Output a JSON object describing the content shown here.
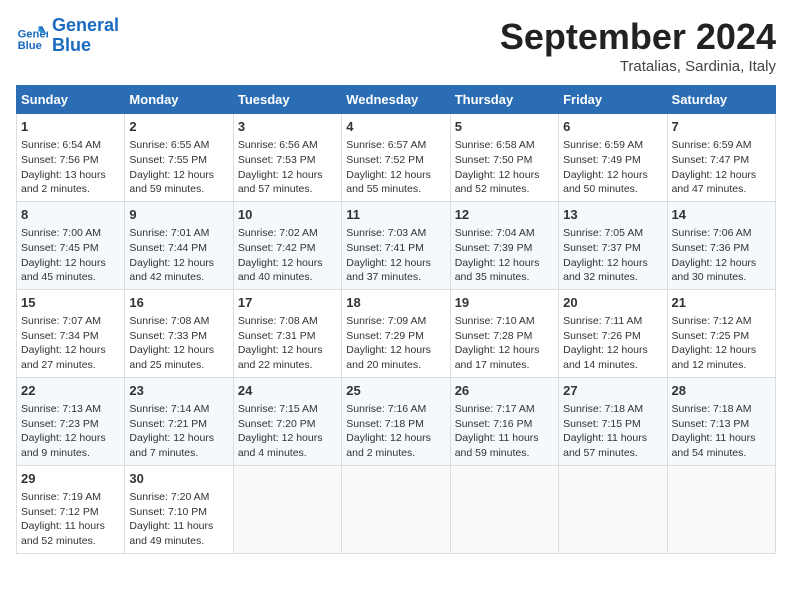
{
  "logo": {
    "line1": "General",
    "line2": "Blue"
  },
  "title": "September 2024",
  "location": "Tratalias, Sardinia, Italy",
  "weekdays": [
    "Sunday",
    "Monday",
    "Tuesday",
    "Wednesday",
    "Thursday",
    "Friday",
    "Saturday"
  ],
  "weeks": [
    [
      {
        "day": "1",
        "lines": [
          "Sunrise: 6:54 AM",
          "Sunset: 7:56 PM",
          "Daylight: 13 hours",
          "and 2 minutes."
        ]
      },
      {
        "day": "2",
        "lines": [
          "Sunrise: 6:55 AM",
          "Sunset: 7:55 PM",
          "Daylight: 12 hours",
          "and 59 minutes."
        ]
      },
      {
        "day": "3",
        "lines": [
          "Sunrise: 6:56 AM",
          "Sunset: 7:53 PM",
          "Daylight: 12 hours",
          "and 57 minutes."
        ]
      },
      {
        "day": "4",
        "lines": [
          "Sunrise: 6:57 AM",
          "Sunset: 7:52 PM",
          "Daylight: 12 hours",
          "and 55 minutes."
        ]
      },
      {
        "day": "5",
        "lines": [
          "Sunrise: 6:58 AM",
          "Sunset: 7:50 PM",
          "Daylight: 12 hours",
          "and 52 minutes."
        ]
      },
      {
        "day": "6",
        "lines": [
          "Sunrise: 6:59 AM",
          "Sunset: 7:49 PM",
          "Daylight: 12 hours",
          "and 50 minutes."
        ]
      },
      {
        "day": "7",
        "lines": [
          "Sunrise: 6:59 AM",
          "Sunset: 7:47 PM",
          "Daylight: 12 hours",
          "and 47 minutes."
        ]
      }
    ],
    [
      {
        "day": "8",
        "lines": [
          "Sunrise: 7:00 AM",
          "Sunset: 7:45 PM",
          "Daylight: 12 hours",
          "and 45 minutes."
        ]
      },
      {
        "day": "9",
        "lines": [
          "Sunrise: 7:01 AM",
          "Sunset: 7:44 PM",
          "Daylight: 12 hours",
          "and 42 minutes."
        ]
      },
      {
        "day": "10",
        "lines": [
          "Sunrise: 7:02 AM",
          "Sunset: 7:42 PM",
          "Daylight: 12 hours",
          "and 40 minutes."
        ]
      },
      {
        "day": "11",
        "lines": [
          "Sunrise: 7:03 AM",
          "Sunset: 7:41 PM",
          "Daylight: 12 hours",
          "and 37 minutes."
        ]
      },
      {
        "day": "12",
        "lines": [
          "Sunrise: 7:04 AM",
          "Sunset: 7:39 PM",
          "Daylight: 12 hours",
          "and 35 minutes."
        ]
      },
      {
        "day": "13",
        "lines": [
          "Sunrise: 7:05 AM",
          "Sunset: 7:37 PM",
          "Daylight: 12 hours",
          "and 32 minutes."
        ]
      },
      {
        "day": "14",
        "lines": [
          "Sunrise: 7:06 AM",
          "Sunset: 7:36 PM",
          "Daylight: 12 hours",
          "and 30 minutes."
        ]
      }
    ],
    [
      {
        "day": "15",
        "lines": [
          "Sunrise: 7:07 AM",
          "Sunset: 7:34 PM",
          "Daylight: 12 hours",
          "and 27 minutes."
        ]
      },
      {
        "day": "16",
        "lines": [
          "Sunrise: 7:08 AM",
          "Sunset: 7:33 PM",
          "Daylight: 12 hours",
          "and 25 minutes."
        ]
      },
      {
        "day": "17",
        "lines": [
          "Sunrise: 7:08 AM",
          "Sunset: 7:31 PM",
          "Daylight: 12 hours",
          "and 22 minutes."
        ]
      },
      {
        "day": "18",
        "lines": [
          "Sunrise: 7:09 AM",
          "Sunset: 7:29 PM",
          "Daylight: 12 hours",
          "and 20 minutes."
        ]
      },
      {
        "day": "19",
        "lines": [
          "Sunrise: 7:10 AM",
          "Sunset: 7:28 PM",
          "Daylight: 12 hours",
          "and 17 minutes."
        ]
      },
      {
        "day": "20",
        "lines": [
          "Sunrise: 7:11 AM",
          "Sunset: 7:26 PM",
          "Daylight: 12 hours",
          "and 14 minutes."
        ]
      },
      {
        "day": "21",
        "lines": [
          "Sunrise: 7:12 AM",
          "Sunset: 7:25 PM",
          "Daylight: 12 hours",
          "and 12 minutes."
        ]
      }
    ],
    [
      {
        "day": "22",
        "lines": [
          "Sunrise: 7:13 AM",
          "Sunset: 7:23 PM",
          "Daylight: 12 hours",
          "and 9 minutes."
        ]
      },
      {
        "day": "23",
        "lines": [
          "Sunrise: 7:14 AM",
          "Sunset: 7:21 PM",
          "Daylight: 12 hours",
          "and 7 minutes."
        ]
      },
      {
        "day": "24",
        "lines": [
          "Sunrise: 7:15 AM",
          "Sunset: 7:20 PM",
          "Daylight: 12 hours",
          "and 4 minutes."
        ]
      },
      {
        "day": "25",
        "lines": [
          "Sunrise: 7:16 AM",
          "Sunset: 7:18 PM",
          "Daylight: 12 hours",
          "and 2 minutes."
        ]
      },
      {
        "day": "26",
        "lines": [
          "Sunrise: 7:17 AM",
          "Sunset: 7:16 PM",
          "Daylight: 11 hours",
          "and 59 minutes."
        ]
      },
      {
        "day": "27",
        "lines": [
          "Sunrise: 7:18 AM",
          "Sunset: 7:15 PM",
          "Daylight: 11 hours",
          "and 57 minutes."
        ]
      },
      {
        "day": "28",
        "lines": [
          "Sunrise: 7:18 AM",
          "Sunset: 7:13 PM",
          "Daylight: 11 hours",
          "and 54 minutes."
        ]
      }
    ],
    [
      {
        "day": "29",
        "lines": [
          "Sunrise: 7:19 AM",
          "Sunset: 7:12 PM",
          "Daylight: 11 hours",
          "and 52 minutes."
        ]
      },
      {
        "day": "30",
        "lines": [
          "Sunrise: 7:20 AM",
          "Sunset: 7:10 PM",
          "Daylight: 11 hours",
          "and 49 minutes."
        ]
      },
      {
        "day": "",
        "lines": []
      },
      {
        "day": "",
        "lines": []
      },
      {
        "day": "",
        "lines": []
      },
      {
        "day": "",
        "lines": []
      },
      {
        "day": "",
        "lines": []
      }
    ]
  ]
}
